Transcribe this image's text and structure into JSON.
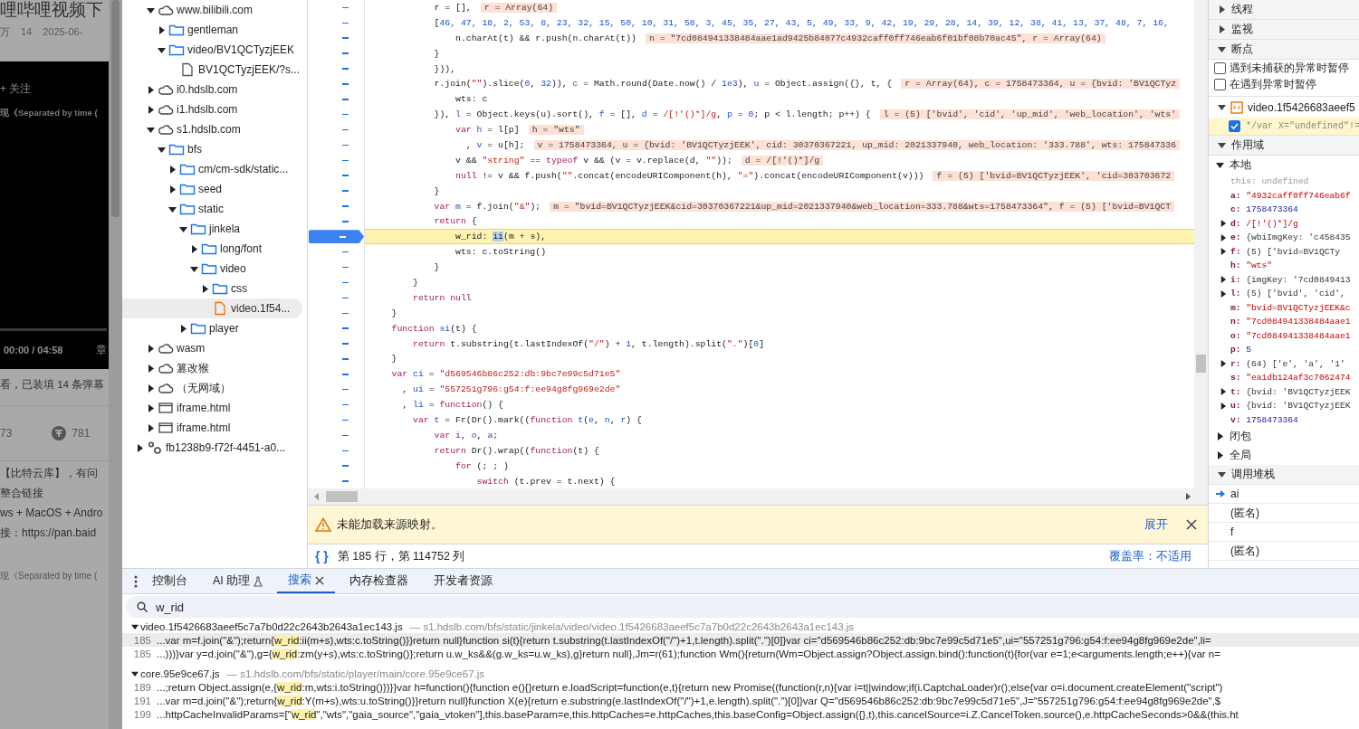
{
  "page": {
    "title": "哩哔哩视频下",
    "stats": [
      "万",
      "14",
      "2025-06-"
    ],
    "player": {
      "follow": "+ 关注",
      "caption": "现《Separated by time (",
      "time": "00:00 / 04:58",
      "chapters": "章"
    },
    "danmaku_info": "看，已装填 14 条弹幕",
    "counts": [
      "73",
      "781"
    ],
    "description": [
      "【比特云库】，有问",
      "整合链接",
      "ws + MacOS + Andro",
      "接：https://pan.baid"
    ],
    "related_title": "现《Separated by time ("
  },
  "file_tree": {
    "items": [
      {
        "label": "www.bilibili.com",
        "kind": "domain",
        "expanded": true,
        "selected": false,
        "children": [
          {
            "label": "gentleman",
            "kind": "folder",
            "expanded": false,
            "selected": false
          },
          {
            "label": "video/BV1QCTyzjEEK",
            "kind": "folder",
            "expanded": true,
            "selected": false,
            "children": [
              {
                "label": "BV1QCTyzjEEK/?s...",
                "kind": "document",
                "selected": false
              }
            ]
          }
        ]
      },
      {
        "label": "i0.hdslb.com",
        "kind": "domain",
        "expanded": false,
        "selected": false
      },
      {
        "label": "i1.hdslb.com",
        "kind": "domain",
        "expanded": false,
        "selected": false
      },
      {
        "label": "s1.hdslb.com",
        "kind": "domain",
        "expanded": true,
        "selected": false,
        "children": [
          {
            "label": "bfs",
            "kind": "folder",
            "expanded": true,
            "selected": false,
            "children": [
              {
                "label": "cm/cm-sdk/static...",
                "kind": "folder",
                "expanded": false,
                "selected": false
              },
              {
                "label": "seed",
                "kind": "folder",
                "expanded": false,
                "selected": false
              },
              {
                "label": "static",
                "kind": "folder",
                "expanded": true,
                "selected": false,
                "children": [
                  {
                    "label": "jinkela",
                    "kind": "folder",
                    "expanded": true,
                    "selected": false,
                    "children": [
                      {
                        "label": "long/font",
                        "kind": "folder",
                        "expanded": false,
                        "selected": false
                      },
                      {
                        "label": "video",
                        "kind": "folder",
                        "expanded": true,
                        "selected": false,
                        "children": [
                          {
                            "label": "css",
                            "kind": "folder",
                            "expanded": false,
                            "selected": false
                          },
                          {
                            "label": "video.1f54...",
                            "kind": "script",
                            "selected": true
                          }
                        ]
                      }
                    ]
                  },
                  {
                    "label": "player",
                    "kind": "folder",
                    "expanded": false,
                    "selected": false
                  }
                ]
              }
            ]
          }
        ]
      },
      {
        "label": "wasm",
        "kind": "domain",
        "expanded": false,
        "selected": false
      },
      {
        "label": "篡改猴",
        "kind": "domain",
        "expanded": false,
        "selected": false
      },
      {
        "label": "（无网域）",
        "kind": "domain",
        "expanded": false,
        "selected": false
      },
      {
        "label": "iframe.html",
        "kind": "frame",
        "expanded": false,
        "selected": false
      },
      {
        "label": "iframe.html",
        "kind": "frame",
        "expanded": false,
        "selected": false
      }
    ],
    "root_items": [
      {
        "label": "fb1238b9-f72f-4451-a0...",
        "kind": "worker",
        "expanded": false,
        "selected": false
      }
    ]
  },
  "editor": {
    "lines": [
      {
        "segments": [
          {
            "kind": "plain",
            "text": "            r = [],"
          }
        ],
        "inline_value": "r = Array(64)",
        "breakpoint": false,
        "current": false
      },
      {
        "segments": [
          {
            "kind": "plain",
            "text": "            ["
          },
          {
            "kind": "number",
            "text": "46, 47, 18, 2, 53, 8, 23, 32, 15, 50, 10, 31, 58, 3, 45, 35, 27, 43, 5, 49, 33, 9, 42, 19, 29, 28, 14, 39, 12, 38, 41, 13, 37, 48, 7, 16,"
          }
        ],
        "breakpoint": false,
        "current": false
      },
      {
        "segments": [
          {
            "kind": "plain",
            "text": "                n.charAt(t) && r.push(n.charAt(t))"
          }
        ],
        "inline_value": "n = \"7cd084941338484aae1ad9425b84077c4932caff0ff746eab6f01bf08b70ac45\", r = Array(64)",
        "breakpoint": false,
        "current": false
      },
      {
        "segments": [
          {
            "kind": "plain",
            "text": "            }"
          }
        ],
        "breakpoint": false,
        "current": false
      },
      {
        "segments": [
          {
            "kind": "plain",
            "text": "            })),"
          }
        ],
        "breakpoint": false,
        "current": false
      },
      {
        "segments": [
          {
            "kind": "plain",
            "text": "            r.join("
          },
          {
            "kind": "string",
            "text": "\"\""
          },
          {
            "kind": "plain",
            "text": ").slice("
          },
          {
            "kind": "number",
            "text": "0"
          },
          {
            "kind": "plain",
            "text": ","
          },
          {
            "kind": "number",
            "text": " 32"
          },
          {
            "kind": "plain",
            "text": ")),"
          },
          {
            "kind": "def",
            "text": " c"
          },
          {
            "kind": "plain",
            "text": " = Math.round(Date.now() /"
          },
          {
            "kind": "number",
            "text": " 1e3"
          },
          {
            "kind": "plain",
            "text": "),"
          },
          {
            "kind": "def",
            "text": " u"
          },
          {
            "kind": "plain",
            "text": " = Object.assign({}, t, {"
          }
        ],
        "inline_value": "r = Array(64), c = 1758473364, u = {bvid: 'BV1QCTyz",
        "breakpoint": false,
        "current": false
      },
      {
        "segments": [
          {
            "kind": "plain",
            "text": "                wts: c"
          }
        ],
        "breakpoint": false,
        "current": false
      },
      {
        "segments": [
          {
            "kind": "plain",
            "text": "            }),"
          },
          {
            "kind": "def",
            "text": " l"
          },
          {
            "kind": "plain",
            "text": " = Object.keys(u).sort(),"
          },
          {
            "kind": "def",
            "text": " f"
          },
          {
            "kind": "plain",
            "text": " = [],"
          },
          {
            "kind": "def",
            "text": " d"
          },
          {
            "kind": "plain",
            "text": " ="
          },
          {
            "kind": "string",
            "text": " /[!'()*]/g"
          },
          {
            "kind": "plain",
            "text": ","
          },
          {
            "kind": "def",
            "text": " p"
          },
          {
            "kind": "plain",
            "text": " ="
          },
          {
            "kind": "number",
            "text": " 0"
          },
          {
            "kind": "plain",
            "text": "; p < l.length; p++) {"
          }
        ],
        "inline_value": "l = (5) ['bvid', 'cid', 'up_mid', 'web_location', 'wts'",
        "breakpoint": false,
        "current": false
      },
      {
        "segments": [
          {
            "kind": "keyword",
            "text": "                var"
          },
          {
            "kind": "def",
            "text": " h"
          },
          {
            "kind": "plain",
            "text": " = l[p]"
          }
        ],
        "inline_value": "h = \"wts\"",
        "breakpoint": false,
        "current": false
      },
      {
        "segments": [
          {
            "kind": "plain",
            "text": "                  ,"
          },
          {
            "kind": "def",
            "text": " v"
          },
          {
            "kind": "plain",
            "text": " = u[h];"
          }
        ],
        "inline_value": "v = 1758473364, u = {bvid: 'BV1QCTyzjEEK', cid: 30370367221, up_mid: 2021337940, web_location: '333.788', wts: 175847336",
        "breakpoint": false,
        "current": false
      },
      {
        "segments": [
          {
            "kind": "plain",
            "text": "                v &&"
          },
          {
            "kind": "string",
            "text": " \"string\""
          },
          {
            "kind": "plain",
            "text": " =="
          },
          {
            "kind": "keyword",
            "text": " typeof"
          },
          {
            "kind": "plain",
            "text": " v && (v = v.replace(d,"
          },
          {
            "kind": "string",
            "text": " \"\""
          },
          {
            "kind": "plain",
            "text": "));"
          }
        ],
        "inline_value": "d = /[!'()*]/g",
        "breakpoint": false,
        "current": false
      },
      {
        "segments": [
          {
            "kind": "keyword",
            "text": "                null"
          },
          {
            "kind": "plain",
            "text": " != v && f.push("
          },
          {
            "kind": "string",
            "text": "\"\""
          },
          {
            "kind": "plain",
            "text": ".concat(encodeURIComponent(h),"
          },
          {
            "kind": "string",
            "text": " \"=\""
          },
          {
            "kind": "plain",
            "text": ").concat(encodeURIComponent(v)))"
          }
        ],
        "inline_value": "f = (5) ['bvid=BV1QCTyzjEEK', 'cid=303703672",
        "breakpoint": false,
        "current": false
      },
      {
        "segments": [
          {
            "kind": "plain",
            "text": "            }"
          }
        ],
        "breakpoint": false,
        "current": false
      },
      {
        "segments": [
          {
            "kind": "keyword",
            "text": "            var"
          },
          {
            "kind": "def",
            "text": " m"
          },
          {
            "kind": "plain",
            "text": " = f.join("
          },
          {
            "kind": "string",
            "text": "\"&\""
          },
          {
            "kind": "plain",
            "text": ");"
          }
        ],
        "inline_value": "m = \"bvid=BV1QCTyzjEEK&cid=30370367221&up_mid=2021337940&web_location=333.788&wts=1758473364\", f = (5) ['bvid=BV1QCT",
        "breakpoint": false,
        "current": false
      },
      {
        "segments": [
          {
            "kind": "keyword",
            "text": "            return"
          },
          {
            "kind": "plain",
            "text": " {"
          }
        ],
        "breakpoint": false,
        "current": false
      },
      {
        "segments": [
          {
            "kind": "plain",
            "text": "                w_rid: "
          },
          {
            "kind": "selection",
            "text": "ii"
          },
          {
            "kind": "plain",
            "text": "(m + s),"
          }
        ],
        "breakpoint": true,
        "current": true
      },
      {
        "segments": [
          {
            "kind": "plain",
            "text": "                wts: c.toString()"
          }
        ],
        "breakpoint": false,
        "current": false
      },
      {
        "segments": [
          {
            "kind": "plain",
            "text": "            }"
          }
        ],
        "breakpoint": false,
        "current": false
      },
      {
        "segments": [
          {
            "kind": "plain",
            "text": "        }"
          }
        ],
        "breakpoint": false,
        "current": false
      },
      {
        "segments": [
          {
            "kind": "keyword",
            "text": "        return null"
          }
        ],
        "breakpoint": false,
        "current": false
      },
      {
        "segments": [
          {
            "kind": "plain",
            "text": "    }"
          }
        ],
        "breakpoint": false,
        "current": false
      },
      {
        "segments": [
          {
            "kind": "keyword",
            "text": "    function"
          },
          {
            "kind": "def",
            "text": " si"
          },
          {
            "kind": "plain",
            "text": "(t) {"
          }
        ],
        "breakpoint": false,
        "current": false
      },
      {
        "segments": [
          {
            "kind": "keyword",
            "text": "        return"
          },
          {
            "kind": "plain",
            "text": " t.substring(t.lastIndexOf("
          },
          {
            "kind": "string",
            "text": "\"/\""
          },
          {
            "kind": "plain",
            "text": ") +"
          },
          {
            "kind": "number",
            "text": " 1"
          },
          {
            "kind": "plain",
            "text": ", t.length).split("
          },
          {
            "kind": "string",
            "text": "\".\""
          },
          {
            "kind": "plain",
            "text": ")["
          },
          {
            "kind": "number",
            "text": "0"
          },
          {
            "kind": "plain",
            "text": "]"
          }
        ],
        "breakpoint": false,
        "current": false
      },
      {
        "segments": [
          {
            "kind": "plain",
            "text": "    }"
          }
        ],
        "breakpoint": false,
        "current": false
      },
      {
        "segments": [
          {
            "kind": "keyword",
            "text": "    var"
          },
          {
            "kind": "def",
            "text": " ci"
          },
          {
            "kind": "plain",
            "text": " ="
          },
          {
            "kind": "string",
            "text": " \"d569546b86c252:db:9bc7e99c5d71e5\""
          }
        ],
        "breakpoint": false,
        "current": false
      },
      {
        "segments": [
          {
            "kind": "plain",
            "text": "      ,"
          },
          {
            "kind": "def",
            "text": " ui"
          },
          {
            "kind": "plain",
            "text": " ="
          },
          {
            "kind": "string",
            "text": " \"557251g796:g54:f:ee94g8fg969e2de\""
          }
        ],
        "breakpoint": false,
        "current": false
      },
      {
        "segments": [
          {
            "kind": "plain",
            "text": "      ,"
          },
          {
            "kind": "def",
            "text": " li"
          },
          {
            "kind": "plain",
            "text": " ="
          },
          {
            "kind": "keyword",
            "text": " function"
          },
          {
            "kind": "plain",
            "text": "() {"
          }
        ],
        "breakpoint": false,
        "current": false
      },
      {
        "segments": [
          {
            "kind": "keyword",
            "text": "        var"
          },
          {
            "kind": "def",
            "text": " t"
          },
          {
            "kind": "plain",
            "text": " = Fr(Dr().mark(("
          },
          {
            "kind": "keyword",
            "text": "function"
          },
          {
            "kind": "def",
            "text": " t"
          },
          {
            "kind": "plain",
            "text": "("
          },
          {
            "kind": "def",
            "text": "e"
          },
          {
            "kind": "plain",
            "text": ","
          },
          {
            "kind": "def",
            "text": " n"
          },
          {
            "kind": "plain",
            "text": ","
          },
          {
            "kind": "def",
            "text": " r"
          },
          {
            "kind": "plain",
            "text": ") {"
          }
        ],
        "breakpoint": false,
        "current": false
      },
      {
        "segments": [
          {
            "kind": "keyword",
            "text": "            var"
          },
          {
            "kind": "def",
            "text": " i"
          },
          {
            "kind": "plain",
            "text": ","
          },
          {
            "kind": "def",
            "text": " o"
          },
          {
            "kind": "plain",
            "text": ","
          },
          {
            "kind": "def",
            "text": " a"
          },
          {
            "kind": "plain",
            "text": ";"
          }
        ],
        "breakpoint": false,
        "current": false
      },
      {
        "segments": [
          {
            "kind": "keyword",
            "text": "            return"
          },
          {
            "kind": "plain",
            "text": " Dr().wrap(("
          },
          {
            "kind": "keyword",
            "text": "function"
          },
          {
            "kind": "plain",
            "text": "(t) {"
          }
        ],
        "breakpoint": false,
        "current": false
      },
      {
        "segments": [
          {
            "kind": "keyword",
            "text": "                for"
          },
          {
            "kind": "plain",
            "text": " (; ; )"
          }
        ],
        "breakpoint": false,
        "current": false
      },
      {
        "segments": [
          {
            "kind": "keyword",
            "text": "                    switch"
          },
          {
            "kind": "plain",
            "text": " (t.prev = t.next) {"
          }
        ],
        "breakpoint": false,
        "current": false
      }
    ],
    "warning": {
      "message": "未能加载来源映射。",
      "action": "展开"
    },
    "status": {
      "format_button": "{ }",
      "position": "第 185 行，第 114752 列",
      "coverage": "覆盖率：不适用"
    }
  },
  "sidebar": {
    "sections": [
      {
        "kind": "plain",
        "label": "线程",
        "expanded": false
      },
      {
        "kind": "plain",
        "label": "监视",
        "expanded": false
      },
      {
        "kind": "breakpoints",
        "label": "断点",
        "expanded": true,
        "options": [
          {
            "label": "遇到未捕获的异常时暂停",
            "checked": false
          },
          {
            "label": "在遇到异常时暂停",
            "checked": false
          }
        ],
        "files": [
          {
            "name": "video.1f5426683aeef5",
            "expanded": true,
            "breakpoints": [
              {
                "code": "*/var X=\"undefined\"!=",
                "checked": true
              }
            ]
          }
        ]
      },
      {
        "kind": "scope",
        "label": "作用域",
        "expanded": true,
        "groups": [
          {
            "label": "本地",
            "expanded": true,
            "variables": [
              {
                "name": "this:",
                "value": "undefined",
                "kind": "undefined",
                "expandable": false
              },
              {
                "name": "a:",
                "value": "\"4932caff0ff746eab6f",
                "kind": "string",
                "expandable": false
              },
              {
                "name": "c:",
                "value": "1758473364",
                "kind": "number",
                "expandable": false
              },
              {
                "name": "d:",
                "value": "/[!'()*]/g",
                "kind": "regex",
                "expandable": true
              },
              {
                "name": "e:",
                "value": "{wbiImgKey: 'c458435",
                "kind": "object",
                "expandable": true
              },
              {
                "name": "f:",
                "value": "(5) ['bvid=BV1QCTy",
                "kind": "object",
                "expandable": true
              },
              {
                "name": "h:",
                "value": "\"wts\"",
                "kind": "string",
                "expandable": false
              },
              {
                "name": "i:",
                "value": "{imgKey: '7cd0849413",
                "kind": "object",
                "expandable": true
              },
              {
                "name": "l:",
                "value": "(5) ['bvid', 'cid',",
                "kind": "object",
                "expandable": true
              },
              {
                "name": "m:",
                "value": "\"bvid=BV1QCTyzjEEK&c",
                "kind": "string",
                "expandable": false
              },
              {
                "name": "n:",
                "value": "\"7cd084941338484aae1",
                "kind": "string",
                "expandable": false
              },
              {
                "name": "o:",
                "value": "\"7cd084941338484aae1",
                "kind": "string",
                "expandable": false
              },
              {
                "name": "p:",
                "value": "5",
                "kind": "number",
                "expandable": false
              },
              {
                "name": "r:",
                "value": "(64) ['e', 'a', '1'",
                "kind": "object",
                "expandable": true
              },
              {
                "name": "s:",
                "value": "\"ea1db124af3c7062474",
                "kind": "string",
                "expandable": false
              },
              {
                "name": "t:",
                "value": "{bvid: 'BV1QCTyzjEEK",
                "kind": "object",
                "expandable": true
              },
              {
                "name": "u:",
                "value": "{bvid: 'BV1QCTyzjEEK",
                "kind": "object",
                "expandable": true
              },
              {
                "name": "v:",
                "value": "1758473364",
                "kind": "number",
                "expandable": false
              }
            ]
          },
          {
            "label": "闭包",
            "expanded": false
          },
          {
            "label": "全局",
            "expanded": false
          }
        ]
      },
      {
        "kind": "callstack",
        "label": "调用堆栈",
        "expanded": true,
        "frames": [
          {
            "label": "ai",
            "current": true
          },
          {
            "label": "(匿名)",
            "current": false
          },
          {
            "label": "f",
            "current": false
          },
          {
            "label": "(匿名)",
            "current": false
          }
        ]
      }
    ]
  },
  "drawer": {
    "tabs": [
      {
        "label": "控制台",
        "kind": "normal",
        "selected": false,
        "closable": false
      },
      {
        "label": "AI 助理",
        "kind": "experimental",
        "selected": false,
        "closable": false
      },
      {
        "label": "搜索",
        "kind": "normal",
        "selected": true,
        "closable": true
      },
      {
        "label": "内存检查器",
        "kind": "normal",
        "selected": false,
        "closable": false
      },
      {
        "label": "开发者资源",
        "kind": "normal",
        "selected": false,
        "closable": false
      }
    ],
    "search": {
      "value": "w_rid"
    },
    "results": [
      {
        "file": "video.1f5426683aeef5c7a7b0d22c2643b2643a1ec143.js",
        "path": "— s1.hdslb.com/bfs/static/jinkela/video/video.1f5426683aeef5c7a7b0d22c2643b2643a1ec143.js",
        "expanded": true,
        "matches": [
          {
            "line": "185",
            "before": "...var m=f.join(\"&\");return{",
            "match": "w_rid",
            "after": ":ii(m+s),wts:c.toString()}}return null}function si(t){return t.substring(t.lastIndexOf(\"/\")+1,t.length).split(\".\")[0]}var ci=\"d569546b86c252:db:9bc7e99c5d71e5\",ui=\"557251g796:g54:f:ee94g8fg969e2de\",li=",
            "selected": true
          },
          {
            "line": "185",
            "before": "...)))}var y=d.join(\"&\"),g={",
            "match": "w_rid",
            "after": ":zm(y+s),wts:c.toString()};return u.w_ks&&(g.w_ks=u.w_ks),g}return null},Jm=r(61);function Wm(){return(Wm=Object.assign?Object.assign.bind():function(t){for(var e=1;e<arguments.length;e++){var n=",
            "selected": false
          }
        ]
      },
      {
        "file": "core.95e9ce67.js",
        "path": "— s1.hdslb.com/bfs/static/player/main/core.95e9ce67.js",
        "expanded": true,
        "matches": [
          {
            "line": "189",
            "before": "...;return Object.assign(e,{",
            "match": "w_rid",
            "after": ":m,wts:i.toString()})}}var h=function(){function e(){}return e.loadScript=function(e,t){return new Promise((function(r,n){var i=t||window;if(i.CaptchaLoader)r();else{var o=i.document.createElement(\"script\")",
            "selected": false
          },
          {
            "line": "191",
            "before": "...var m=d.join(\"&\");return{",
            "match": "w_rid",
            "after": ":Y(m+s),wts:u.toString()}}return null}function X(e){return e.substring(e.lastIndexOf(\"/\")+1,e.length).split(\".\")[0]}var Q=\"d569546b86c252:db:9bc7e99c5d71e5\",J=\"557251g796:g54:f:ee94g8fg969e2de\",$",
            "selected": false
          },
          {
            "line": "199",
            "before": "...httpCacheInvalidParams=[\"",
            "match": "w_rid",
            "after": "\",\"wts\",\"gaia_source\",\"gaia_vtoken\"],this.baseParam=e,this.httpCaches=e.httpCaches,this.baseConfig=Object.assign({},t),this.cancelSource=i.Z.CancelToken.source(),e.httpCacheSeconds>0&&(this.ht",
            "selected": false
          }
        ]
      }
    ]
  }
}
